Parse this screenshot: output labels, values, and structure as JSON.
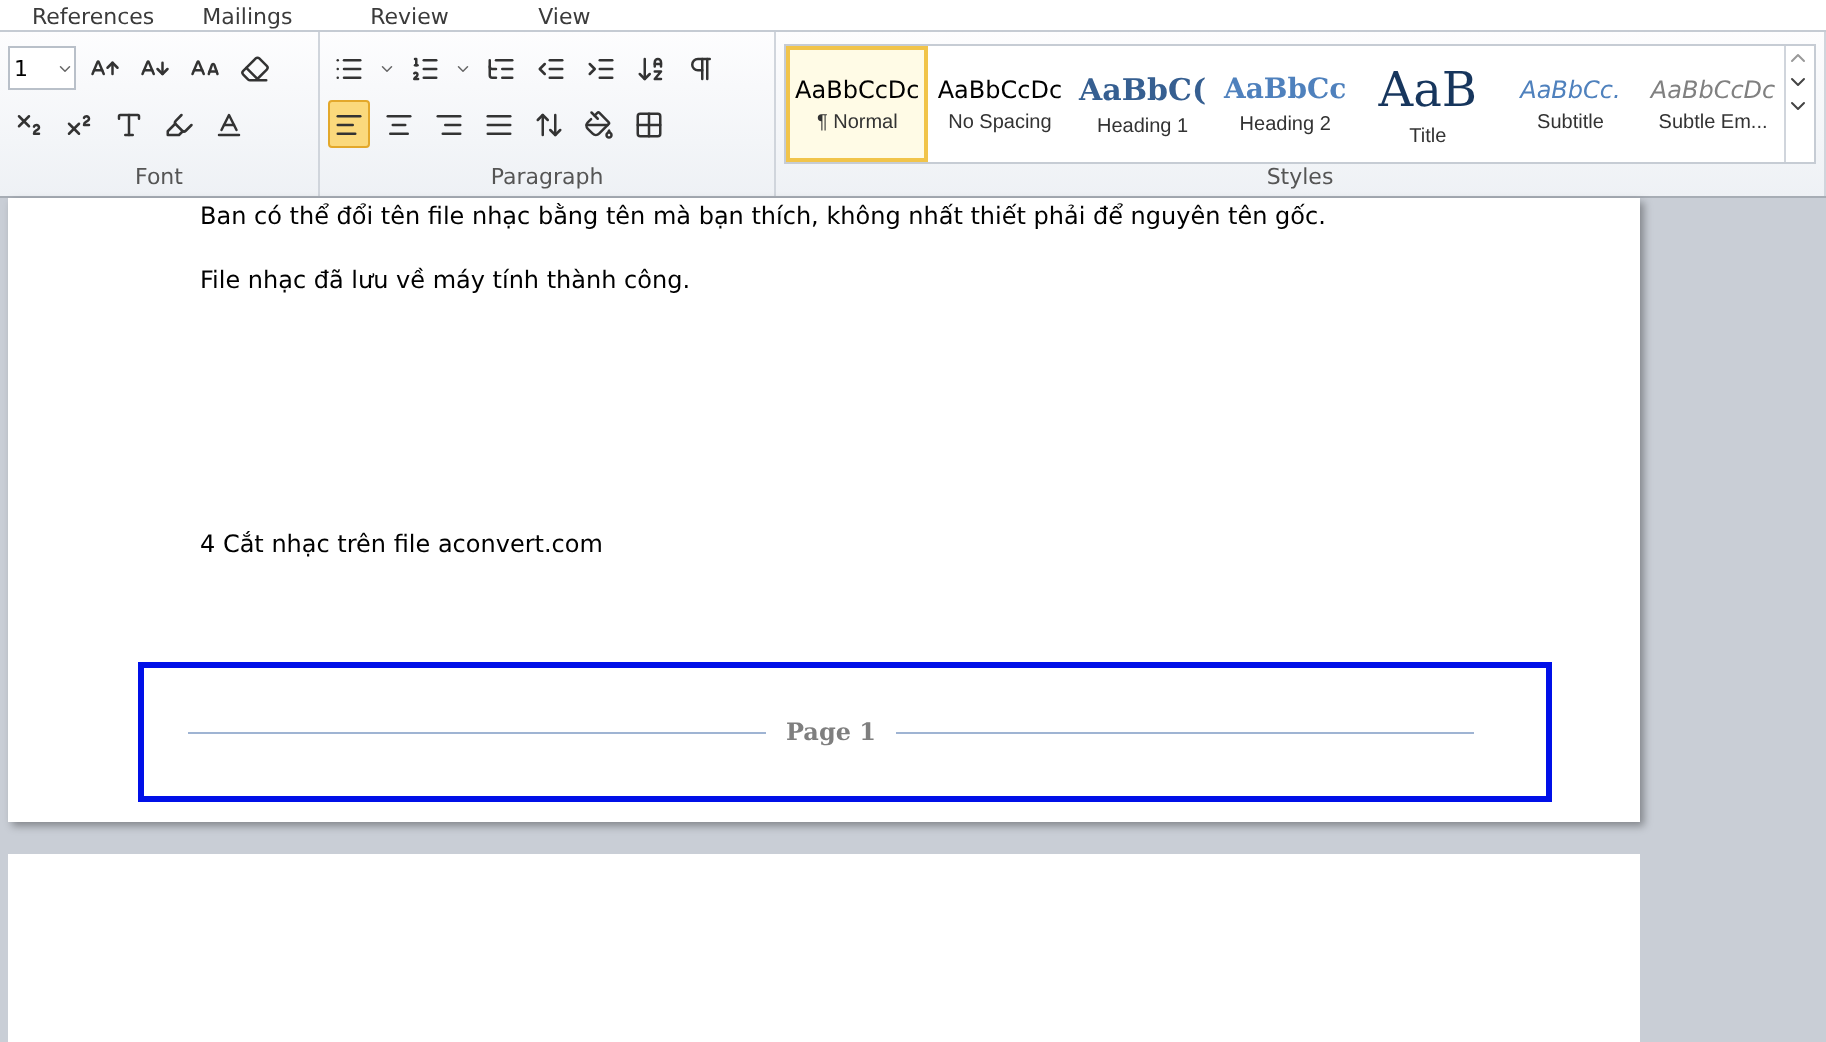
{
  "tabs": [
    "References",
    "Mailings",
    "Review",
    "View"
  ],
  "font_group": {
    "font_size": "1",
    "label": "Font"
  },
  "paragraph_group": {
    "label": "Paragraph",
    "alignments": [
      {
        "kind": "left",
        "selected": true
      },
      {
        "kind": "center",
        "selected": false
      },
      {
        "kind": "right",
        "selected": false
      },
      {
        "kind": "justify",
        "selected": false
      }
    ]
  },
  "styles_group": {
    "label": "Styles",
    "styles": [
      {
        "kind": "normal",
        "sample": "AaBbCcDc",
        "name": "¶ Normal",
        "selected": true
      },
      {
        "kind": "no_spacing",
        "sample": "AaBbCcDc",
        "name": "No Spacing",
        "selected": false
      },
      {
        "kind": "heading1",
        "sample": "AaBbC(",
        "name": "Heading 1",
        "selected": false
      },
      {
        "kind": "heading2",
        "sample": "AaBbCc",
        "name": "Heading 2",
        "selected": false
      },
      {
        "kind": "title",
        "sample": "AaB",
        "name": "Title",
        "selected": false
      },
      {
        "kind": "subtitle",
        "sample": "AaBbCc.",
        "name": "Subtitle",
        "selected": false
      },
      {
        "kind": "subtle",
        "sample": "AaBbCcDc",
        "name": "Subtle Em...",
        "selected": false
      }
    ]
  },
  "document": {
    "paragraphs": [
      {
        "kind": "body",
        "text": "Ban có thể đổi tên file nhạc bằng tên mà bạn thích, không nhất thiết phải để nguyên tên gốc."
      },
      {
        "kind": "body",
        "text": "File nhạc đã lưu về máy tính thành công."
      },
      {
        "kind": "gap"
      },
      {
        "kind": "body",
        "text": "4 Cắt nhạc trên file aconvert.com"
      }
    ],
    "footer": {
      "text": "Page 1"
    }
  }
}
